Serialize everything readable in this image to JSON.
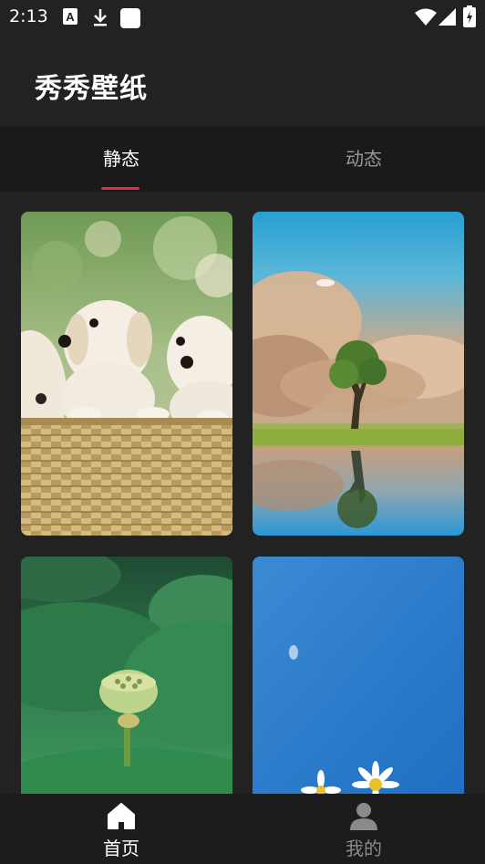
{
  "status_bar": {
    "time": "2:13",
    "left_icons": [
      "font-icon",
      "download-icon",
      "square-app-icon"
    ],
    "right_icons": [
      "wifi-icon",
      "signal-icon",
      "battery-icon"
    ]
  },
  "app": {
    "title": "秀秀壁纸"
  },
  "tabs": [
    {
      "label": "静态",
      "active": true
    },
    {
      "label": "动态",
      "active": false
    }
  ],
  "colors": {
    "background": "#222222",
    "tab_indicator": "#d8314f",
    "text_active": "#ffffff",
    "text_inactive": "#9a9a9a"
  },
  "wallpapers": [
    {
      "subject": "puppies-in-basket"
    },
    {
      "subject": "tree-by-lake"
    },
    {
      "subject": "lotus-seedpod"
    },
    {
      "subject": "daisies-blue-sky"
    }
  ],
  "bottom_nav": [
    {
      "label": "首页",
      "icon": "home-icon",
      "active": true
    },
    {
      "label": "我的",
      "icon": "person-icon",
      "active": false
    }
  ]
}
